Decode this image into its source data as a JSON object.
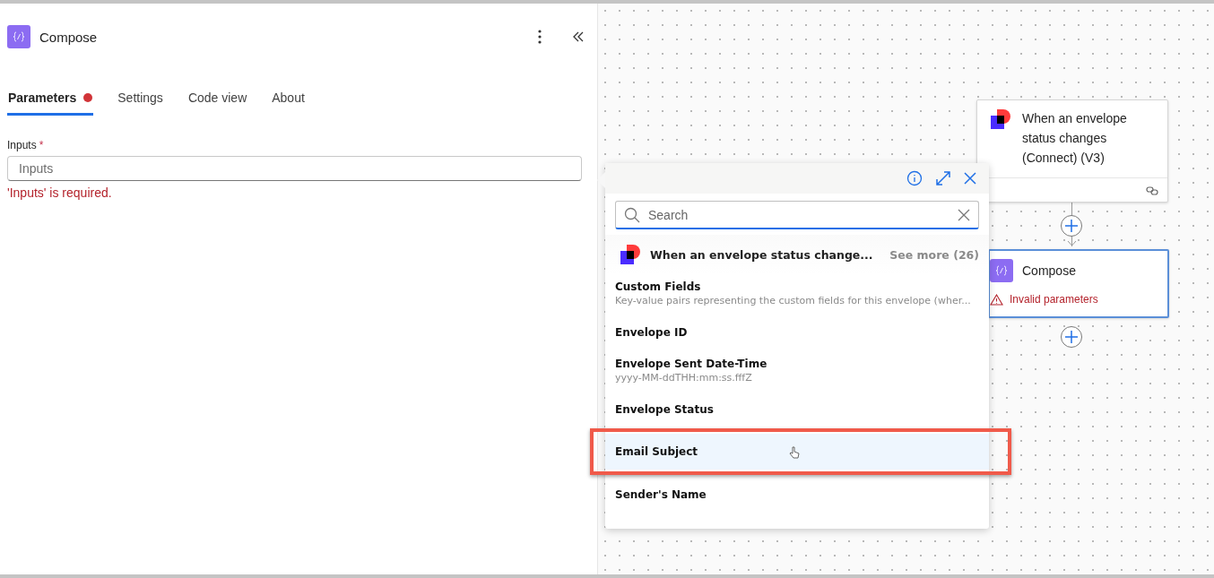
{
  "panel": {
    "title": "Compose",
    "tabs": [
      {
        "label": "Parameters",
        "selected": true,
        "error": true
      },
      {
        "label": "Settings",
        "selected": false,
        "error": false
      },
      {
        "label": "Code view",
        "selected": false,
        "error": false
      },
      {
        "label": "About",
        "selected": false,
        "error": false
      }
    ],
    "field": {
      "label": "Inputs",
      "required_mark": "*",
      "placeholder": "Inputs",
      "error": "'Inputs' is required."
    }
  },
  "picker": {
    "search_placeholder": "Search",
    "source": {
      "title": "When an envelope status change...",
      "see_more": "See more (26)"
    },
    "items": [
      {
        "title": "Custom Fields",
        "description": "Key-value pairs representing the custom fields for this envelope (wher...",
        "highlighted": false
      },
      {
        "title": "Envelope ID",
        "highlighted": false
      },
      {
        "title": "Envelope Sent Date-Time",
        "description": "yyyy-MM-ddTHH:mm:ss.fffZ",
        "highlighted": false
      },
      {
        "title": "Envelope Status",
        "highlighted": false
      },
      {
        "title": "Email Subject",
        "highlighted": true
      },
      {
        "title": "Sender's Name",
        "highlighted": false
      }
    ]
  },
  "flow": {
    "nodes": [
      {
        "kind": "trigger",
        "title": "When an envelope status changes (Connect) (V3)",
        "selected": false
      },
      {
        "kind": "action",
        "title": "Compose",
        "error": "Invalid parameters",
        "selected": true
      }
    ]
  }
}
